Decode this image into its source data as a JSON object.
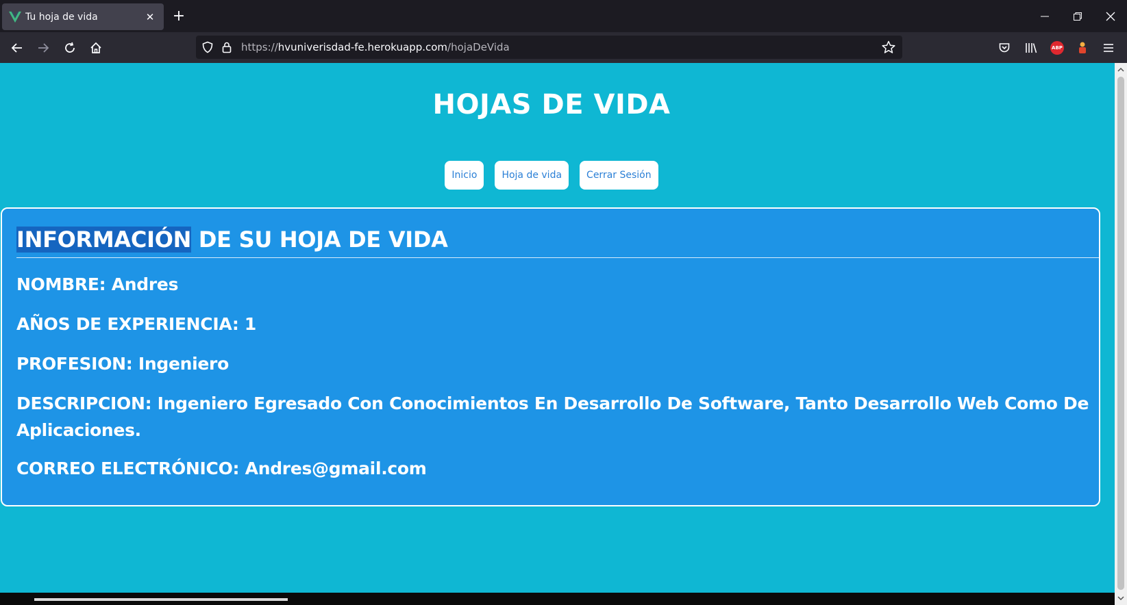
{
  "browser": {
    "tab": {
      "title": "Tu hoja de vida",
      "favicon": "vue-logo-icon"
    },
    "url": {
      "prefix": "https://",
      "host": "hvuniverisdad-fe.herokuapp.com",
      "path": "/hojaDeVida"
    }
  },
  "page": {
    "title": "HOJAS DE VIDA",
    "nav": [
      {
        "label": "Inicio"
      },
      {
        "label": "Hoja de vida"
      },
      {
        "label": "Cerrar Sesión"
      }
    ],
    "card": {
      "heading_selected": "INFORMACIÓN",
      "heading_rest": " DE SU HOJA DE VIDA",
      "fields": [
        {
          "text": "NOMBRE: Andres"
        },
        {
          "text": "AÑOS DE EXPERIENCIA: 1"
        },
        {
          "text": "PROFESION: Ingeniero"
        },
        {
          "text": "DESCRIPCION: Ingeniero Egresado Con Conocimientos En Desarrollo De Software, Tanto Desarrollo Web Como De Aplicaciones."
        },
        {
          "text": "CORREO ELECTRÓNICO: Andres@gmail.com"
        }
      ]
    }
  },
  "colors": {
    "page_bg": "#0fb7d3",
    "card_bg": "#1e94e6",
    "button_text": "#2a7fd6",
    "selection": "#1565c0"
  }
}
